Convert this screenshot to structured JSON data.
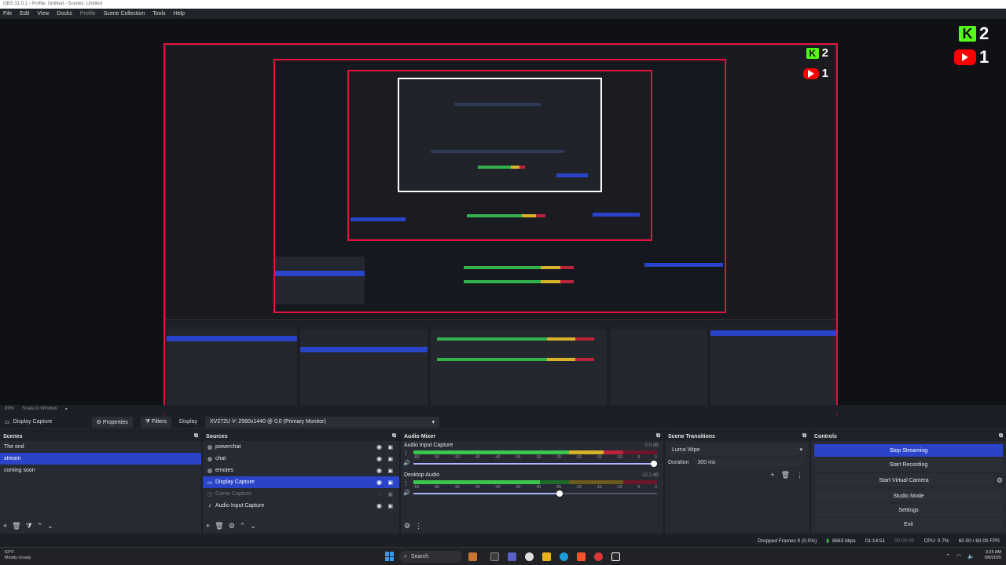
{
  "window": {
    "title": "OBS 31.0.1 - Profile: Untitled - Scenes: Untitled"
  },
  "menu": [
    "File",
    "Edit",
    "View",
    "Docks",
    "Profile",
    "Scene Collection",
    "Tools",
    "Help"
  ],
  "overlay": {
    "kick_count": "2",
    "youtube_count": "1"
  },
  "status_row": {
    "zoom": "89%",
    "scale_mode": "Scale to Window"
  },
  "source_toolbar": {
    "source_name": "Display Capture",
    "properties_label": "Properties",
    "filters_label": "Filters",
    "display_label": "Display",
    "display_value": "XV272U V: 2560x1440 @ 0,0 (Primary Monitor)"
  },
  "scenes": {
    "title": "Scenes",
    "items": [
      "The end",
      "stream",
      "coming soon"
    ],
    "selected": 1
  },
  "sources": {
    "title": "Sources",
    "items": [
      {
        "label": "powerchat",
        "icon": "browser-icon"
      },
      {
        "label": "chat",
        "icon": "browser-icon"
      },
      {
        "label": "emotes",
        "icon": "browser-icon"
      },
      {
        "label": "Display Capture",
        "icon": "monitor-icon"
      },
      {
        "label": "Game Capture",
        "icon": "gamepad-icon"
      },
      {
        "label": "Audio Input Capture",
        "icon": "mic-icon"
      }
    ]
  },
  "audio_mixer": {
    "title": "Audio Mixer",
    "channels": [
      {
        "name": "Audio Input Capture",
        "db": "0.0 dB",
        "level": 0.86,
        "volume": 1.0
      },
      {
        "name": "Desktop Audio",
        "db": "-12.2 dB",
        "level": 0.55,
        "volume": 0.6
      }
    ],
    "scale": [
      "-60",
      "-55",
      "-50",
      "-45",
      "-40",
      "-35",
      "-30",
      "-25",
      "-20",
      "-15",
      "-10",
      "-5",
      "0"
    ]
  },
  "transitions": {
    "title": "Scene Transitions",
    "selected": "Luma Wipe",
    "duration_label": "Duration",
    "duration_value": "300 ms"
  },
  "controls": {
    "title": "Controls",
    "buttons": [
      "Stop Streaming",
      "Start Recording",
      "Start Virtual Camera",
      "Studio Mode",
      "Settings",
      "Exit"
    ]
  },
  "bottom_status": {
    "dropped_frames": "Dropped Frames 0 (0.0%)",
    "bitrate": "8663 kbps",
    "stream_time": "01:14:51",
    "record_time": "00:00:00",
    "cpu": "CPU: 0.7%",
    "fps": "60.00 / 60.00 FPS"
  },
  "taskbar": {
    "weather_temp": "63°F",
    "weather_desc": "Mostly cloudy",
    "search_placeholder": "Search",
    "time": "3:25 AM",
    "date": "5/8/2025"
  },
  "colors": {
    "accent": "#2944c9",
    "canvas_border": "#e3123d",
    "kick": "#53fc18",
    "youtube": "#ff0000"
  }
}
